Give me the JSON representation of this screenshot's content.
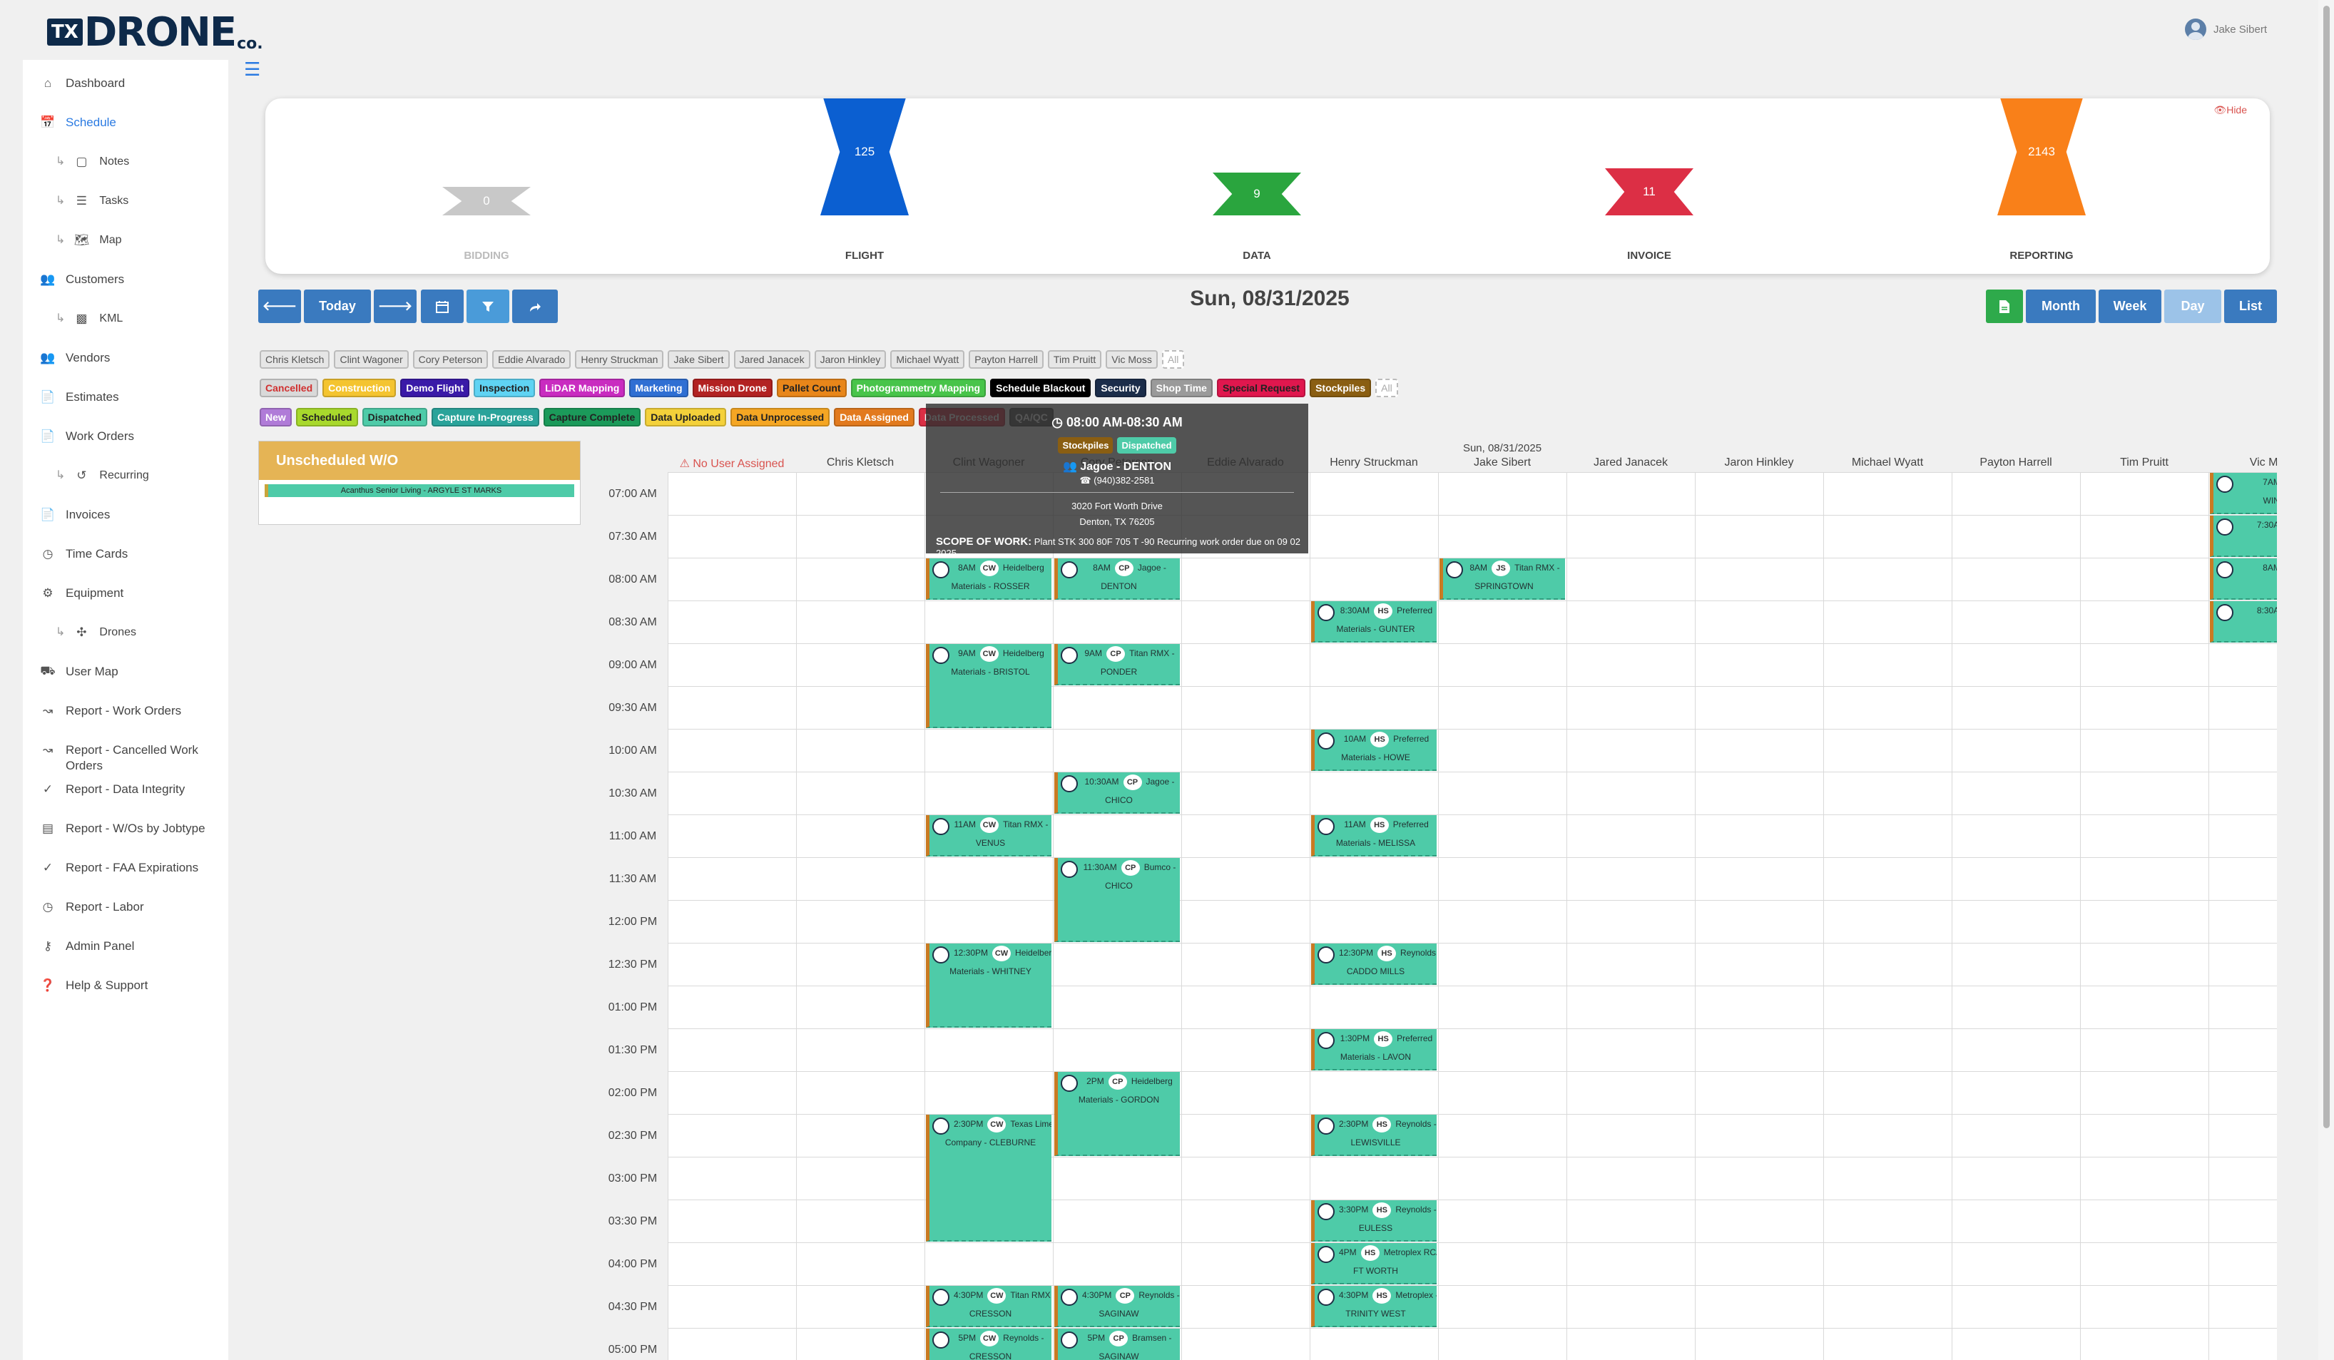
{
  "header": {
    "logo": {
      "tx": "TX",
      "main": "DRONE",
      "suffix": "co."
    },
    "user_name": "Jake Sibert"
  },
  "sidebar": {
    "items": [
      {
        "label": "Dashboard",
        "icon": "home-icon",
        "sub": false
      },
      {
        "label": "Schedule",
        "icon": "calendar-icon",
        "sub": false,
        "active": true
      },
      {
        "label": "Notes",
        "icon": "note-icon",
        "sub": true
      },
      {
        "label": "Tasks",
        "icon": "tasks-icon",
        "sub": true
      },
      {
        "label": "Map",
        "icon": "map-icon",
        "sub": true
      },
      {
        "label": "Customers",
        "icon": "users-icon",
        "sub": false
      },
      {
        "label": "KML",
        "icon": "kml-icon",
        "sub": true
      },
      {
        "label": "Vendors",
        "icon": "vendors-icon",
        "sub": false
      },
      {
        "label": "Estimates",
        "icon": "estimates-icon",
        "sub": false
      },
      {
        "label": "Work Orders",
        "icon": "work-orders-icon",
        "sub": false
      },
      {
        "label": "Recurring",
        "icon": "recurring-icon",
        "sub": true
      },
      {
        "label": "Invoices",
        "icon": "invoices-icon",
        "sub": false
      },
      {
        "label": "Time Cards",
        "icon": "clock-icon",
        "sub": false
      },
      {
        "label": "Equipment",
        "icon": "equipment-icon",
        "sub": false
      },
      {
        "label": "Drones",
        "icon": "drone-icon",
        "sub": true
      },
      {
        "label": "User Map",
        "icon": "truck-icon",
        "sub": false
      },
      {
        "label": "Report - Work Orders",
        "icon": "line-chart-icon",
        "sub": false
      },
      {
        "label": "Report - Cancelled Work Orders",
        "icon": "line-chart-icon",
        "sub": false
      },
      {
        "label": "Report - Data Integrity",
        "icon": "check-icon",
        "sub": false
      },
      {
        "label": "Report - W/Os by Jobtype",
        "icon": "bar-chart-icon",
        "sub": false
      },
      {
        "label": "Report - FAA Expirations",
        "icon": "check-icon",
        "sub": false
      },
      {
        "label": "Report - Labor",
        "icon": "clock-icon",
        "sub": false
      },
      {
        "label": "Admin Panel",
        "icon": "key-icon",
        "sub": false
      },
      {
        "label": "Help & Support",
        "icon": "help-icon",
        "sub": false
      }
    ]
  },
  "funnel": {
    "hide_label": "Hide",
    "stages": [
      {
        "label": "BIDDING",
        "value": "0",
        "color": "#c8c8c8"
      },
      {
        "label": "FLIGHT",
        "value": "125",
        "color": "#0b5fd1"
      },
      {
        "label": "DATA",
        "value": "9",
        "color": "#2aa53e"
      },
      {
        "label": "INVOICE",
        "value": "11",
        "color": "#dc2f45"
      },
      {
        "label": "REPORTING",
        "value": "2143",
        "color": "#f98019"
      }
    ]
  },
  "toolbar": {
    "prev": "🡐",
    "today": "Today",
    "next": "🡒",
    "date_title": "Sun, 08/31/2025",
    "views": [
      "Month",
      "Week",
      "Day",
      "List"
    ]
  },
  "filters": {
    "users": [
      "Chris Kletsch",
      "Clint Wagoner",
      "Cory Peterson",
      "Eddie Alvarado",
      "Henry Struckman",
      "Jake Sibert",
      "Jared Janacek",
      "Jaron Hinkley",
      "Michael Wyatt",
      "Payton Harrell",
      "Tim Pruitt",
      "Vic Moss",
      "All"
    ],
    "types": [
      {
        "label": "Cancelled",
        "bg": "#d9d9d9",
        "fg": "#d03030"
      },
      {
        "label": "Construction",
        "bg": "#f4c430",
        "fg": "#ffffff"
      },
      {
        "label": "Demo Flight",
        "bg": "#3a1aa8",
        "fg": "#ffffff"
      },
      {
        "label": "Inspection",
        "bg": "#5fd3f3",
        "fg": "#222222"
      },
      {
        "label": "LiDAR Mapping",
        "bg": "#c92cc0",
        "fg": "#ffffff"
      },
      {
        "label": "Marketing",
        "bg": "#2f6fd3",
        "fg": "#ffffff"
      },
      {
        "label": "Mission Drone",
        "bg": "#b22222",
        "fg": "#ffffff"
      },
      {
        "label": "Pallet Count",
        "bg": "#e8861a",
        "fg": "#222222"
      },
      {
        "label": "Photogrammetry Mapping",
        "bg": "#48c44a",
        "fg": "#ffffff"
      },
      {
        "label": "Schedule Blackout",
        "bg": "#000000",
        "fg": "#ffffff"
      },
      {
        "label": "Security",
        "bg": "#1b2d4a",
        "fg": "#ffffff"
      },
      {
        "label": "Shop Time",
        "bg": "#9a9a9a",
        "fg": "#ffffff"
      },
      {
        "label": "Special Request",
        "bg": "#e0174e",
        "fg": "#222222"
      },
      {
        "label": "Stockpiles",
        "bg": "#8a5e12",
        "fg": "#ffffff"
      },
      {
        "label": "All",
        "bg": "#ffffff",
        "fg": "#aaaaaa"
      }
    ],
    "statuses": [
      {
        "label": "New",
        "bg": "#b07bd8",
        "fg": "#ffffff"
      },
      {
        "label": "Scheduled",
        "bg": "#a8d92c",
        "fg": "#222222"
      },
      {
        "label": "Dispatched",
        "bg": "#4ecba8",
        "fg": "#222222"
      },
      {
        "label": "Capture In-Progress",
        "bg": "#2aa39a",
        "fg": "#ffffff"
      },
      {
        "label": "Capture Complete",
        "bg": "#1b9a5a",
        "fg": "#222222"
      },
      {
        "label": "Data Uploaded",
        "bg": "#f4d13a",
        "fg": "#222222"
      },
      {
        "label": "Data Unprocessed",
        "bg": "#f5a623",
        "fg": "#222222"
      },
      {
        "label": "Data Assigned",
        "bg": "#e27a1e",
        "fg": "#ffffff"
      },
      {
        "label": "Data Processed",
        "bg": "#dc2f45",
        "fg": "#ffffff"
      },
      {
        "label": "QA/QC",
        "bg": "#555555",
        "fg": "#ffffff"
      }
    ]
  },
  "unscheduled": {
    "title": "Unscheduled W/O",
    "items": [
      "Acanthus Senior Living - ARGYLE ST MARKS"
    ]
  },
  "calendar": {
    "date_header": "Sun, 08/31/2025",
    "columns": [
      "No User Assigned",
      "Chris Kletsch",
      "Clint Wagoner",
      "Cory Peterson",
      "Eddie Alvarado",
      "Henry Struckman",
      "Jake Sibert",
      "Jared Janacek",
      "Jaron Hinkley",
      "Michael Wyatt",
      "Payton Harrell",
      "Tim Pruitt",
      "Vic Moss"
    ],
    "times": [
      "07:00 AM",
      "07:30 AM",
      "08:00 AM",
      "08:30 AM",
      "09:00 AM",
      "09:30 AM",
      "10:00 AM",
      "10:30 AM",
      "11:00 AM",
      "11:30 AM",
      "12:00 PM",
      "12:30 PM",
      "01:00 PM",
      "01:30 PM",
      "02:00 PM",
      "02:30 PM",
      "03:00 PM",
      "03:30 PM",
      "04:00 PM",
      "04:30 PM",
      "05:00 PM"
    ],
    "events": [
      {
        "col": 2,
        "start": 2,
        "dur": 1,
        "time": "8AM",
        "badge": "CW",
        "name": "Heidelberg",
        "loc": "Materials - ROSSER"
      },
      {
        "col": 2,
        "start": 4,
        "dur": 2,
        "time": "9AM",
        "badge": "CW",
        "name": "Heidelberg",
        "loc": "Materials - BRISTOL"
      },
      {
        "col": 2,
        "start": 8,
        "dur": 1,
        "time": "11AM",
        "badge": "CW",
        "name": "Titan RMX -",
        "loc": "VENUS"
      },
      {
        "col": 2,
        "start": 11,
        "dur": 2,
        "time": "12:30PM",
        "badge": "CW",
        "name": "Heidelberg",
        "loc": "Materials - WHITNEY"
      },
      {
        "col": 2,
        "start": 15,
        "dur": 3,
        "time": "2:30PM",
        "badge": "CW",
        "name": "Texas Lime",
        "loc": "Company - CLEBURNE"
      },
      {
        "col": 2,
        "start": 19,
        "dur": 1,
        "time": "4:30PM",
        "badge": "CW",
        "name": "Titan RMX -",
        "loc": "CRESSON"
      },
      {
        "col": 2,
        "start": 20,
        "dur": 1,
        "time": "5PM",
        "badge": "CW",
        "name": "Reynolds -",
        "loc": "CRESSON"
      },
      {
        "col": 3,
        "start": 2,
        "dur": 1,
        "time": "8AM",
        "badge": "CP",
        "name": "Jagoe -",
        "loc": "DENTON"
      },
      {
        "col": 3,
        "start": 4,
        "dur": 1,
        "time": "9AM",
        "badge": "CP",
        "name": "Titan RMX -",
        "loc": "PONDER"
      },
      {
        "col": 3,
        "start": 7,
        "dur": 1,
        "time": "10:30AM",
        "badge": "CP",
        "name": "Jagoe -",
        "loc": "CHICO"
      },
      {
        "col": 3,
        "start": 9,
        "dur": 2,
        "time": "11:30AM",
        "badge": "CP",
        "name": "Bumco -",
        "loc": "CHICO"
      },
      {
        "col": 3,
        "start": 14,
        "dur": 2,
        "time": "2PM",
        "badge": "CP",
        "name": "Heidelberg",
        "loc": "Materials - GORDON"
      },
      {
        "col": 3,
        "start": 19,
        "dur": 1,
        "time": "4:30PM",
        "badge": "CP",
        "name": "Reynolds -",
        "loc": "SAGINAW"
      },
      {
        "col": 3,
        "start": 20,
        "dur": 1,
        "time": "5PM",
        "badge": "CP",
        "name": "Bramsen -",
        "loc": "SAGINAW"
      },
      {
        "col": 5,
        "start": 3,
        "dur": 1,
        "time": "8:30AM",
        "badge": "HS",
        "name": "Preferred",
        "loc": "Materials - GUNTER"
      },
      {
        "col": 5,
        "start": 6,
        "dur": 1,
        "time": "10AM",
        "badge": "HS",
        "name": "Preferred",
        "loc": "Materials - HOWE"
      },
      {
        "col": 5,
        "start": 8,
        "dur": 1,
        "time": "11AM",
        "badge": "HS",
        "name": "Preferred",
        "loc": "Materials - MELISSA"
      },
      {
        "col": 5,
        "start": 11,
        "dur": 1,
        "time": "12:30PM",
        "badge": "HS",
        "name": "Reynolds -",
        "loc": "CADDO MILLS"
      },
      {
        "col": 5,
        "start": 13,
        "dur": 1,
        "time": "1:30PM",
        "badge": "HS",
        "name": "Preferred",
        "loc": "Materials - LAVON"
      },
      {
        "col": 5,
        "start": 15,
        "dur": 1,
        "time": "2:30PM",
        "badge": "HS",
        "name": "Reynolds -",
        "loc": "LEWISVILLE"
      },
      {
        "col": 5,
        "start": 17,
        "dur": 1,
        "time": "3:30PM",
        "badge": "HS",
        "name": "Reynolds -",
        "loc": "EULESS"
      },
      {
        "col": 5,
        "start": 18,
        "dur": 1,
        "time": "4PM",
        "badge": "HS",
        "name": "Metroplex RCA -",
        "loc": "FT WORTH"
      },
      {
        "col": 5,
        "start": 19,
        "dur": 1,
        "time": "4:30PM",
        "badge": "HS",
        "name": "Metroplex -",
        "loc": "TRINITY WEST"
      },
      {
        "col": 6,
        "start": 2,
        "dur": 1,
        "time": "8AM",
        "badge": "JS",
        "name": "Titan RMX -",
        "loc": "SPRINGTOWN"
      },
      {
        "col": 12,
        "start": 0,
        "dur": 1,
        "time": "7AM",
        "badge": "VM",
        "name": "",
        "loc": "WIND"
      },
      {
        "col": 12,
        "start": 1,
        "dur": 1,
        "time": "7:30AM",
        "badge": "VM",
        "name": "",
        "loc": ""
      },
      {
        "col": 12,
        "start": 2,
        "dur": 1,
        "time": "8AM",
        "badge": "VM",
        "name": "",
        "loc": ""
      },
      {
        "col": 12,
        "start": 3,
        "dur": 1,
        "time": "8:30AM",
        "badge": "VM",
        "name": "",
        "loc": ""
      }
    ]
  },
  "tooltip": {
    "time": "08:00 AM-08:30 AM",
    "tag1": "Stockpiles",
    "tag2": "Dispatched",
    "title": "Jagoe - DENTON",
    "phone": "(940)382-2581",
    "addr1": "3020 Fort Worth Drive",
    "addr2": "Denton, TX 76205",
    "scope_label": "SCOPE OF WORK:",
    "scope": "Plant STK 300 80F 705 T -90 Recurring work order due on 09 02 2025"
  }
}
